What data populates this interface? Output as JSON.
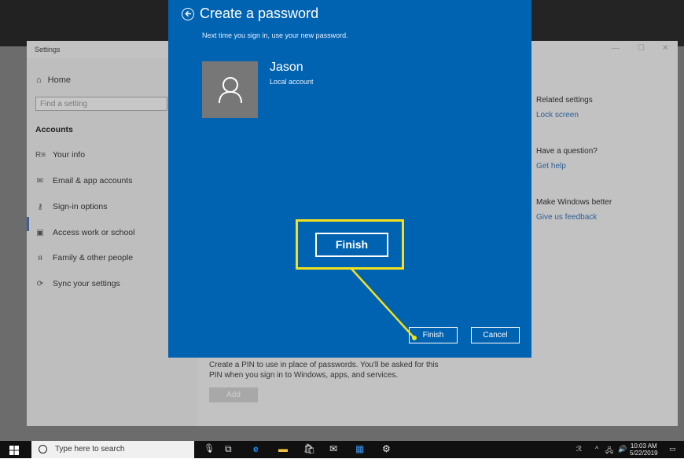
{
  "settings": {
    "window_title": "Settings",
    "nav": {
      "home": "Home",
      "search_placeholder": "Find a setting",
      "section": "Accounts",
      "items": [
        {
          "label": "Your info",
          "icon": "person-card-icon"
        },
        {
          "label": "Email & app accounts",
          "icon": "mail-icon"
        },
        {
          "label": "Sign-in options",
          "icon": "key-icon"
        },
        {
          "label": "Access work or school",
          "icon": "briefcase-icon"
        },
        {
          "label": "Family & other people",
          "icon": "person-add-icon"
        },
        {
          "label": "Sync your settings",
          "icon": "sync-icon"
        }
      ]
    },
    "related": {
      "heading": "Related settings",
      "link": "Lock screen",
      "question_heading": "Have a question?",
      "question_link": "Get help",
      "feedback_heading": "Make Windows better",
      "feedback_link": "Give us feedback"
    },
    "pin": {
      "description": "Create a PIN to use in place of passwords. You'll be asked for this PIN when you sign in to Windows, apps, and services.",
      "add_label": "Add"
    }
  },
  "dialog": {
    "title": "Create a password",
    "subtitle": "Next time you sign in, use your new password.",
    "account_name": "Jason",
    "account_type": "Local account",
    "finish_label": "Finish",
    "cancel_label": "Cancel",
    "accent_color": "#0063b1"
  },
  "callout": {
    "label": "Finish",
    "color": "#f3e11f"
  },
  "taskbar": {
    "search_placeholder": "Type here to search",
    "time": "10:03 AM",
    "date": "5/22/2019"
  }
}
